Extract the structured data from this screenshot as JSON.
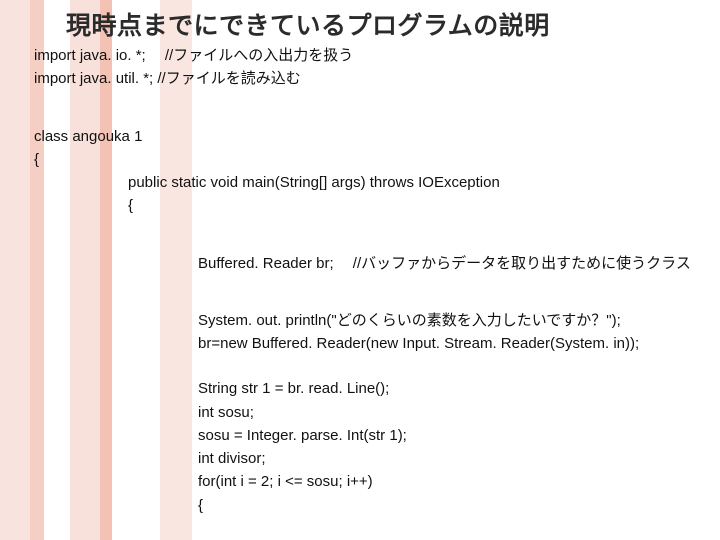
{
  "title": "現時点までにできているプログラムの説明",
  "lines": {
    "l01": "import java. io. *; 　//ファイルへの入出力を扱う",
    "l02": "import java. util. *;  //ファイルを読み込む",
    "l03": "class angouka 1",
    "l04": "{",
    "l05": "public static void main(String[] args) throws IOException",
    "l06": "{",
    "l07": "Buffered. Reader br; 　//バッファからデータを取り出すために使うクラス",
    "l08": "System. out. println(\"どのくらいの素数を入力したいですか？\");",
    "l09": "br=new Buffered. Reader(new Input. Stream. Reader(System. in));",
    "l10": "String str 1 = br. read. Line();",
    "l11": "int sosu;",
    "l12": "sosu = Integer. parse. Int(str 1);",
    "l13": "int divisor;",
    "l14": "for(int i = 2; i <= sosu; i++)",
    "l15": "{"
  }
}
